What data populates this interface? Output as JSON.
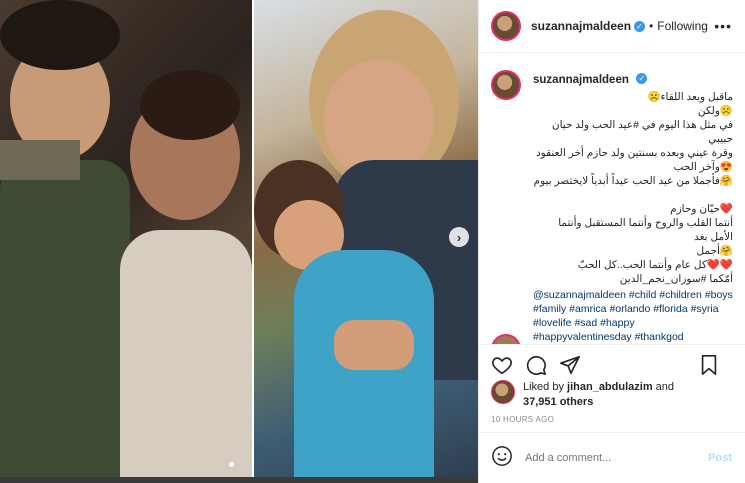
{
  "colors": {
    "link": "#00376b",
    "verified": "#3897f0",
    "post_disabled": "#b2dffc",
    "story_ring": "#e1306c"
  },
  "header": {
    "username": "suzannajmaldeen",
    "separator": "•",
    "follow_label": "Following",
    "more_icon": "more-options-icon"
  },
  "caption": {
    "username": "suzannajmaldeen",
    "arabic": "ماقبل وبعد اللقاء☹️\n☹️ولكن\nفي مثل هذا اليوم في #عيد الحب ولد حيان حبيبي\nوقرة عيني وبعده بسنتين ولد حازم أخر العنقود\n😍وآخر الحب\n🤗فأجملا من عيد الحب عيداً أبدياً لايختصر بيوم\n\n❤️حيّان وحازم\nأنتما القلب والروح وأنتما المستقبل وأنتما الأمل بغد\n🤗أجمل\n❤️❤️كل عام وأنتما الحب..كل الحبّ\nأمّكما #سوزان_نجم_الدين",
    "tags": "@suzannajmaldeen #child #children #boys #family #amrica #orlando #florida #syria #lovelife #sad #happy #happyvalentinesday #thankgod",
    "time": "10h"
  },
  "likes": {
    "prefix": "Liked by ",
    "user": "jihan_abdulazim",
    "and": " and",
    "count": "37,951 others"
  },
  "timeago": "10 HOURS AGO",
  "add_comment": {
    "placeholder": "Add a comment...",
    "post_label": "Post"
  },
  "carousel": {
    "total_slides": 2,
    "active_slide": 1
  }
}
